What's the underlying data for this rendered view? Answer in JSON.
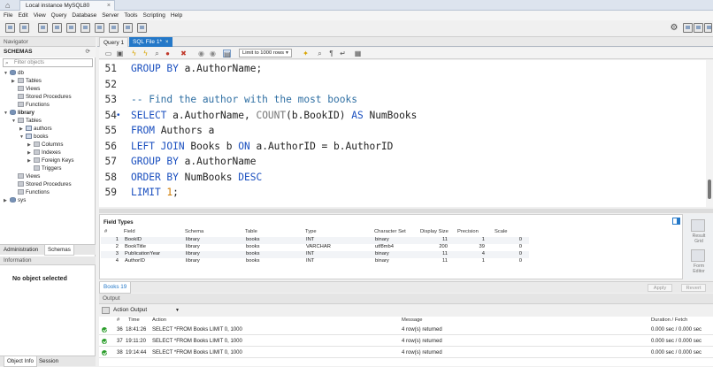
{
  "connection_tab": {
    "label": "Local instance MySQL80"
  },
  "menu": [
    "File",
    "Edit",
    "View",
    "Query",
    "Database",
    "Server",
    "Tools",
    "Scripting",
    "Help"
  ],
  "navigator": {
    "header": "Navigator",
    "schemas_title": "SCHEMAS",
    "filter_placeholder": "Filter objects",
    "tree": {
      "db": "db",
      "db_tables": "Tables",
      "db_views": "Views",
      "db_procs": "Stored Procedures",
      "db_funcs": "Functions",
      "library": "library",
      "lib_tables": "Tables",
      "authors": "authors",
      "books": "books",
      "columns": "Columns",
      "indexes": "Indexes",
      "fkeys": "Foreign Keys",
      "triggers": "Triggers",
      "lib_views": "Views",
      "lib_procs": "Stored Procedures",
      "lib_funcs": "Functions",
      "sys": "sys"
    },
    "tabs": {
      "administration": "Administration",
      "schemas": "Schemas"
    },
    "info_header": "Information",
    "no_object": "No object selected",
    "bottom_tabs": {
      "object_info": "Object Info",
      "session": "Session"
    }
  },
  "query_tabs": {
    "q1": "Query 1",
    "sqlfile": "SQL File 1*",
    "close": "×"
  },
  "editor_toolbar": {
    "limit": "Limit to 1000 rows"
  },
  "code_lines": [
    {
      "num": "51",
      "marker": "",
      "parts": [
        [
          "k",
          "GROUP BY "
        ],
        [
          "p",
          "a.AuthorName;"
        ]
      ]
    },
    {
      "num": "52",
      "marker": "",
      "parts": []
    },
    {
      "num": "53",
      "marker": "",
      "parts": [
        [
          "c",
          "-- Find the author with the most books"
        ]
      ]
    },
    {
      "num": "54",
      "marker": "•",
      "parts": [
        [
          "k",
          "SELECT "
        ],
        [
          "p",
          "a.AuthorName, "
        ],
        [
          "f",
          "COUNT"
        ],
        [
          "p",
          "(b.BookID) "
        ],
        [
          "k",
          "AS "
        ],
        [
          "p",
          "NumBooks"
        ]
      ]
    },
    {
      "num": "55",
      "marker": "",
      "parts": [
        [
          "k",
          "FROM "
        ],
        [
          "p",
          "Authors a"
        ]
      ]
    },
    {
      "num": "56",
      "marker": "",
      "parts": [
        [
          "k",
          "LEFT JOIN "
        ],
        [
          "p",
          "Books b "
        ],
        [
          "k",
          "ON "
        ],
        [
          "p",
          "a.AuthorID = b.AuthorID"
        ]
      ]
    },
    {
      "num": "57",
      "marker": "",
      "parts": [
        [
          "k",
          "GROUP BY "
        ],
        [
          "p",
          "a.AuthorName"
        ]
      ]
    },
    {
      "num": "58",
      "marker": "",
      "parts": [
        [
          "k",
          "ORDER BY "
        ],
        [
          "p",
          "NumBooks "
        ],
        [
          "k",
          "DESC"
        ]
      ]
    },
    {
      "num": "59",
      "marker": "",
      "parts": [
        [
          "k",
          "LIMIT "
        ],
        [
          "n",
          "1"
        ],
        [
          "p",
          ";"
        ]
      ]
    }
  ],
  "field_types": {
    "title": "Field Types",
    "headers": [
      "#",
      "Field",
      "Schema",
      "Table",
      "Type",
      "Character Set",
      "Display Size",
      "Precision",
      "Scale"
    ],
    "rows": [
      [
        "1",
        "BookID",
        "library",
        "books",
        "INT",
        "binary",
        "11",
        "1",
        "0"
      ],
      [
        "2",
        "BookTitle",
        "library",
        "books",
        "VARCHAR",
        "utf8mb4",
        "200",
        "39",
        "0"
      ],
      [
        "3",
        "PublicationYear",
        "library",
        "books",
        "INT",
        "binary",
        "11",
        "4",
        "0"
      ],
      [
        "4",
        "AuthorID",
        "library",
        "books",
        "INT",
        "binary",
        "11",
        "1",
        "0"
      ]
    ]
  },
  "side_panel": {
    "result_grid": "Result\nGrid",
    "form_editor": "Form\nEditor"
  },
  "result_bar": {
    "tab": "Books 19",
    "apply": "Apply",
    "revert": "Revert"
  },
  "output": {
    "header": "Output",
    "selector": "Action Output",
    "headers": {
      "num": "#",
      "time": "Time",
      "action": "Action",
      "message": "Message",
      "duration": "Duration / Fetch"
    },
    "rows": [
      {
        "num": "36",
        "time": "18:41:26",
        "action": "SELECT *FROM Books LIMIT 0, 1000",
        "message": "4 row(s) returned",
        "duration": "0.000 sec / 0.000 sec"
      },
      {
        "num": "37",
        "time": "19:11:20",
        "action": "SELECT *FROM Books LIMIT 0, 1000",
        "message": "4 row(s) returned",
        "duration": "0.000 sec / 0.000 sec"
      },
      {
        "num": "38",
        "time": "19:14:44",
        "action": "SELECT *FROM Books LIMIT 0, 1000",
        "message": "4 row(s) returned",
        "duration": "0.000 sec / 0.000 sec"
      }
    ]
  }
}
